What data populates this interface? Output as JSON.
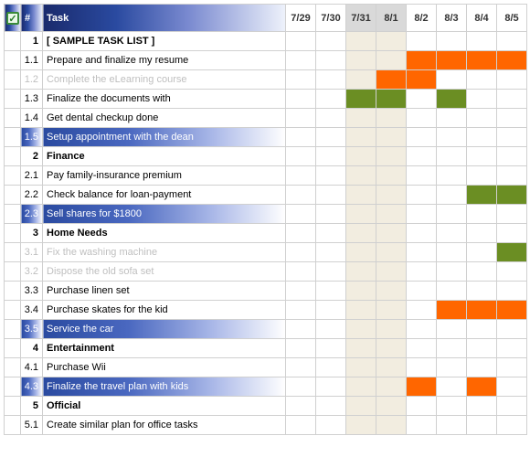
{
  "header": {
    "check_icon": "✓",
    "num_label": "#",
    "task_label": "Task",
    "dates": [
      "7/29",
      "7/30",
      "7/31",
      "8/1",
      "8/2",
      "8/3",
      "8/4",
      "8/5"
    ],
    "weekend_cols": [
      2,
      3
    ]
  },
  "rows": [
    {
      "num": "1",
      "task": "[ SAMPLE TASK LIST ]",
      "sub": false,
      "state": "",
      "bars": []
    },
    {
      "num": "1.1",
      "task": "Prepare and finalize my resume",
      "sub": true,
      "state": "",
      "bars": [
        {
          "c": 4,
          "k": "or"
        },
        {
          "c": 5,
          "k": "or"
        },
        {
          "c": 6,
          "k": "or"
        },
        {
          "c": 7,
          "k": "or"
        }
      ]
    },
    {
      "num": "1.2",
      "task": "Complete the eLearning course",
      "sub": true,
      "state": "dim",
      "bars": [
        {
          "c": 3,
          "k": "or"
        },
        {
          "c": 4,
          "k": "or"
        }
      ]
    },
    {
      "num": "1.3",
      "task": "Finalize the documents with",
      "sub": true,
      "state": "",
      "bars": [
        {
          "c": 2,
          "k": "gr"
        },
        {
          "c": 3,
          "k": "gr"
        },
        {
          "c": 5,
          "k": "gr"
        }
      ]
    },
    {
      "num": "1.4",
      "task": "Get dental checkup done",
      "sub": true,
      "state": "",
      "bars": []
    },
    {
      "num": "1.5",
      "task": "Setup appointment with the dean",
      "sub": true,
      "state": "hl",
      "bars": []
    },
    {
      "num": "2",
      "task": "Finance",
      "sub": false,
      "state": "",
      "bars": []
    },
    {
      "num": "2.1",
      "task": "Pay family-insurance premium",
      "sub": true,
      "state": "",
      "bars": []
    },
    {
      "num": "2.2",
      "task": "Check balance for loan-payment",
      "sub": true,
      "state": "",
      "bars": [
        {
          "c": 6,
          "k": "gr"
        },
        {
          "c": 7,
          "k": "gr"
        }
      ]
    },
    {
      "num": "2.3",
      "task": "Sell shares for $1800",
      "sub": true,
      "state": "hl",
      "bars": []
    },
    {
      "num": "3",
      "task": "Home Needs",
      "sub": false,
      "state": "",
      "bars": []
    },
    {
      "num": "3.1",
      "task": "Fix the washing machine",
      "sub": true,
      "state": "dim",
      "bars": [
        {
          "c": 7,
          "k": "gr"
        }
      ]
    },
    {
      "num": "3.2",
      "task": "Dispose the old sofa set",
      "sub": true,
      "state": "dim",
      "bars": []
    },
    {
      "num": "3.3",
      "task": "Purchase linen set",
      "sub": true,
      "state": "",
      "bars": []
    },
    {
      "num": "3.4",
      "task": "Purchase skates for the kid",
      "sub": true,
      "state": "",
      "bars": [
        {
          "c": 5,
          "k": "or"
        },
        {
          "c": 6,
          "k": "or"
        },
        {
          "c": 7,
          "k": "or"
        }
      ]
    },
    {
      "num": "3.5",
      "task": "Service the car",
      "sub": true,
      "state": "hl",
      "bars": []
    },
    {
      "num": "4",
      "task": "Entertainment",
      "sub": false,
      "state": "",
      "bars": []
    },
    {
      "num": "4.1",
      "task": "Purchase Wii",
      "sub": true,
      "state": "",
      "bars": []
    },
    {
      "num": "4.3",
      "task": "Finalize the travel plan with kids",
      "sub": true,
      "state": "hl",
      "bars": [
        {
          "c": 4,
          "k": "or"
        },
        {
          "c": 6,
          "k": "or"
        }
      ]
    },
    {
      "num": "5",
      "task": "Official",
      "sub": false,
      "state": "",
      "bars": []
    },
    {
      "num": "5.1",
      "task": "Create similar plan for office tasks",
      "sub": true,
      "state": "",
      "bars": []
    }
  ]
}
